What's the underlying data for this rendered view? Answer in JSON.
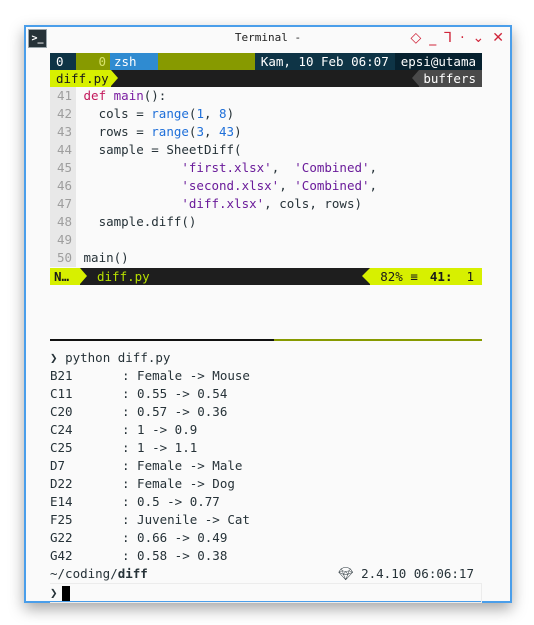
{
  "window": {
    "title": "Terminal -",
    "icon": "terminal-icon",
    "controls": [
      {
        "name": "keep-above",
        "glyph": "◇"
      },
      {
        "name": "minimize",
        "glyph": "_"
      },
      {
        "name": "maximize",
        "glyph": "⅂"
      },
      {
        "name": "shade",
        "glyph": "·"
      },
      {
        "name": "menu",
        "glyph": "⌄"
      },
      {
        "name": "close",
        "glyph": "✕"
      }
    ]
  },
  "tmux": {
    "session": "0",
    "window_index": "0",
    "window_name": "zsh",
    "datetime": "Kam, 10 Feb 06:07",
    "host": "epsi@utama"
  },
  "vim": {
    "tab": "diff.py",
    "buffers_label": "buffers",
    "lines": [
      {
        "n": "41",
        "tokens": [
          [
            "kw",
            "def "
          ],
          [
            "fn",
            "main"
          ],
          [
            "tx",
            "():"
          ]
        ]
      },
      {
        "n": "42",
        "tokens": [
          [
            "tx",
            "  cols = "
          ],
          [
            "bi",
            "range"
          ],
          [
            "tx",
            "("
          ],
          [
            "num",
            "1"
          ],
          [
            "tx",
            ", "
          ],
          [
            "num",
            "8"
          ],
          [
            "tx",
            ")"
          ]
        ]
      },
      {
        "n": "43",
        "tokens": [
          [
            "tx",
            "  rows = "
          ],
          [
            "bi",
            "range"
          ],
          [
            "tx",
            "("
          ],
          [
            "num",
            "3"
          ],
          [
            "tx",
            ", "
          ],
          [
            "num",
            "43"
          ],
          [
            "tx",
            ")"
          ]
        ]
      },
      {
        "n": "44",
        "tokens": [
          [
            "tx",
            "  sample = SheetDiff("
          ]
        ]
      },
      {
        "n": "45",
        "tokens": [
          [
            "tx",
            "             "
          ],
          [
            "str",
            "'first.xlsx'"
          ],
          [
            "tx",
            ",  "
          ],
          [
            "str",
            "'Combined'"
          ],
          [
            "tx",
            ","
          ]
        ]
      },
      {
        "n": "46",
        "tokens": [
          [
            "tx",
            "             "
          ],
          [
            "str",
            "'second.xlsx'"
          ],
          [
            "tx",
            ", "
          ],
          [
            "str",
            "'Combined'"
          ],
          [
            "tx",
            ","
          ]
        ]
      },
      {
        "n": "47",
        "tokens": [
          [
            "tx",
            "             "
          ],
          [
            "str",
            "'diff.xlsx'"
          ],
          [
            "tx",
            ", cols, rows)"
          ]
        ]
      },
      {
        "n": "48",
        "tokens": [
          [
            "tx",
            "  sample.diff()"
          ]
        ]
      },
      {
        "n": "49",
        "tokens": []
      },
      {
        "n": "50",
        "tokens": [
          [
            "tx",
            "main()"
          ]
        ]
      }
    ],
    "status": {
      "mode": "N…",
      "filename": "diff.py",
      "percent": "82%",
      "percent_icon": "≡",
      "line": "41:",
      "col": "1"
    }
  },
  "shell": {
    "prompt_char": "❯",
    "command": "python diff.py",
    "output": [
      {
        "cell": "B21",
        "change": ": Female -> Mouse"
      },
      {
        "cell": "C11",
        "change": ": 0.55 -> 0.54"
      },
      {
        "cell": "C20",
        "change": ": 0.57 -> 0.36"
      },
      {
        "cell": "C24",
        "change": ": 1 -> 0.9"
      },
      {
        "cell": "C25",
        "change": ": 1 -> 1.1"
      },
      {
        "cell": "D7",
        "change": ": Female -> Male"
      },
      {
        "cell": "D22",
        "change": ": Female -> Dog"
      },
      {
        "cell": "E14",
        "change": ": 0.5 -> 0.77"
      },
      {
        "cell": "F25",
        "change": ": Juvenile -> Cat"
      },
      {
        "cell": "G22",
        "change": ": 0.66 -> 0.49"
      },
      {
        "cell": "G42",
        "change": ": 0.58 -> 0.38"
      }
    ],
    "cwd_prefix": "~/coding/",
    "cwd_dir": "diff",
    "ruby_icon": "gem-icon",
    "ruby_version": "2.4.10",
    "time": "06:06:17"
  },
  "colors": {
    "accent_lime": "#d7f000",
    "olive": "#879a00",
    "tmux_dark": "#0e3446",
    "tmux_blue": "#2f8bd1",
    "window_border": "#4a9eea",
    "control_red": "#d0253a"
  }
}
